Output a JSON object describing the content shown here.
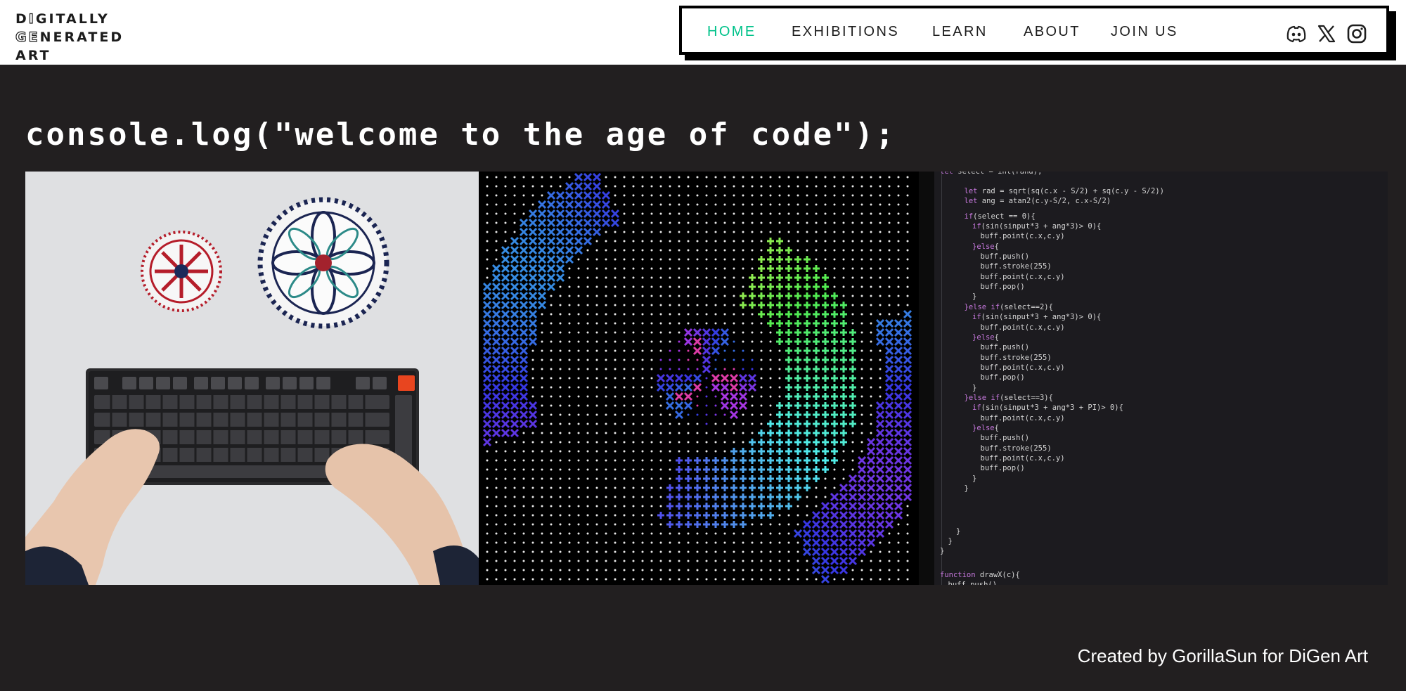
{
  "logo": {
    "lines": [
      "DIGITALLY",
      "GENERATED",
      "ART"
    ]
  },
  "nav": {
    "items": [
      {
        "label": "HOME",
        "active": true
      },
      {
        "label": "EXHIBITIONS",
        "active": false
      },
      {
        "label": "LEARN",
        "active": false
      },
      {
        "label": "ABOUT",
        "active": false
      },
      {
        "label": "JOIN US",
        "active": false
      }
    ],
    "active_color": "#00c28a",
    "social": [
      "discord-icon",
      "x-icon",
      "instagram-icon"
    ]
  },
  "hero": {
    "headline": "console.log(\"welcome to the age of code\");"
  },
  "code_panel": {
    "lines": [
      "let select = int(rand);",
      "let rad = sqrt(sq(c.x - S/2) + sq(c.y - S/2))",
      "let ang = atan2(c.y-S/2, c.x-S/2)",
      "if(select == 0){",
      "if(sin(sinput*3 + ang*3)> 0){",
      "buff.point(c.x,c.y)",
      "}else{",
      "buff.push()",
      "buff.stroke(255)",
      "buff.point(c.x,c.y)",
      "buff.pop()",
      "}",
      "}else if(select==2){",
      "if(sin(sinput*3 + ang*3)> 0){",
      "buff.point(c.x,c.y)",
      "}else{",
      "buff.push()",
      "buff.stroke(255)",
      "buff.point(c.x,c.y)",
      "buff.pop()",
      "}",
      "}else if(select==3){",
      "if(sin(sinput*3 + ang*3 + PI)> 0){",
      "buff.point(c.x,c.y)",
      "}else{",
      "buff.push()",
      "buff.stroke(255)",
      "buff.point(c.x,c.y)",
      "buff.pop()",
      "}",
      "}",
      "}",
      "}",
      "}",
      "function drawX(c){",
      "buff.push()"
    ]
  },
  "footer": {
    "credit": "Created by GorillaSun for DiGen Art"
  },
  "colors": {
    "page_bg": "#221f20",
    "header_bg": "#ffffff",
    "text_dark": "#1e1e1e"
  }
}
